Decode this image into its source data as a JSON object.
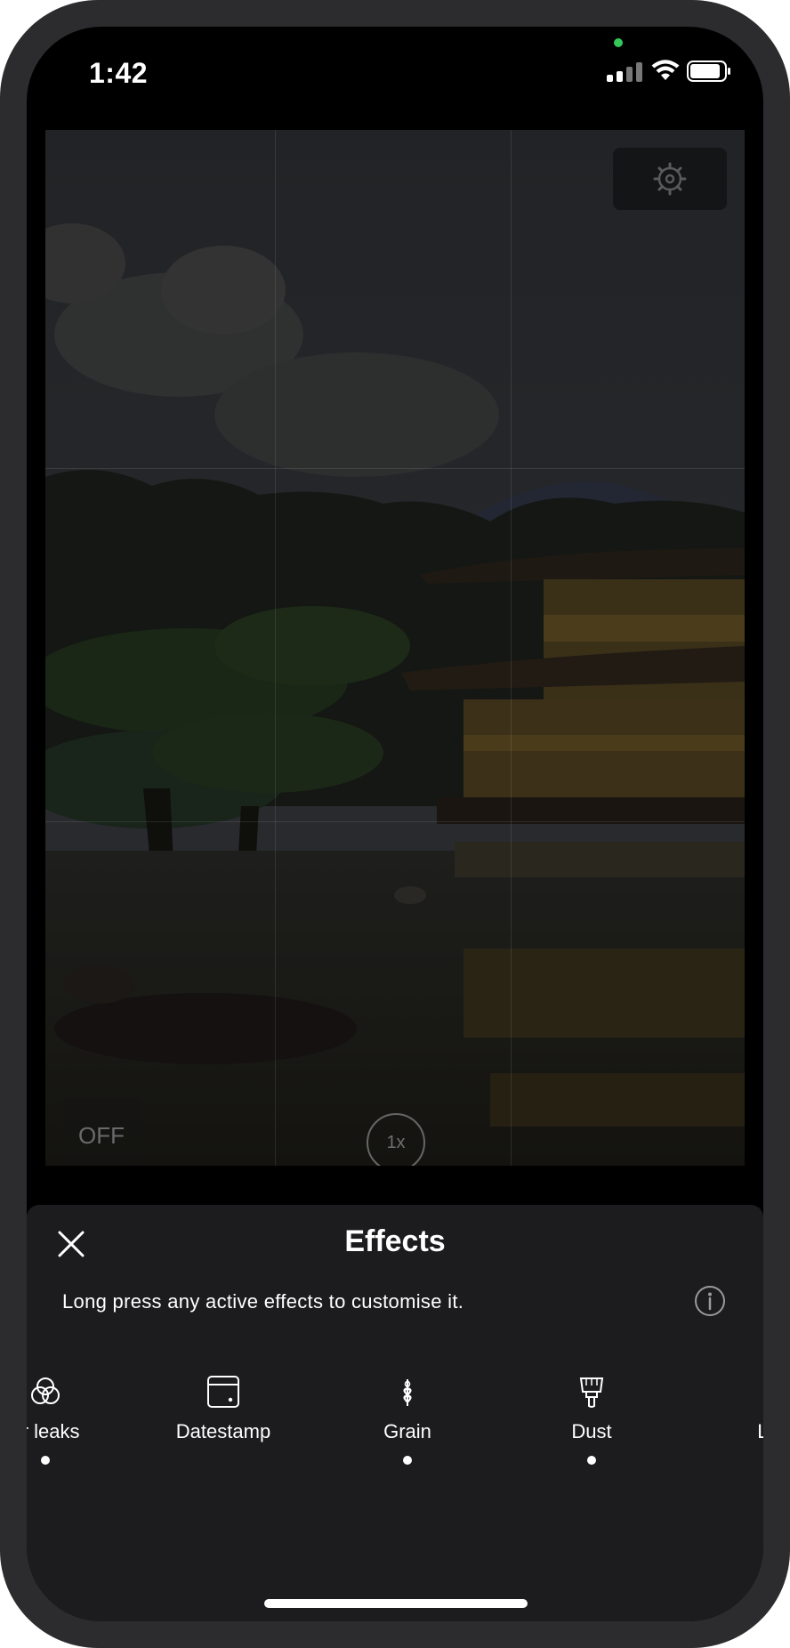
{
  "status_bar": {
    "time": "1:42"
  },
  "camera": {
    "flash_label": "OFF",
    "zoom_label": "1x",
    "settings_icon": "gear-icon"
  },
  "effects_sheet": {
    "title": "Effects",
    "hint": "Long press any active effects to customise it.",
    "close_icon": "close-icon",
    "info_icon": "info-icon",
    "items": [
      {
        "label": "ur leaks",
        "icon": "colour-leaks-icon",
        "active": true
      },
      {
        "label": "Datestamp",
        "icon": "datestamp-icon",
        "active": false
      },
      {
        "label": "Grain",
        "icon": "grain-icon",
        "active": true
      },
      {
        "label": "Dust",
        "icon": "dust-icon",
        "active": true
      },
      {
        "label": "Ligh",
        "icon": "light-icon",
        "active": false
      }
    ]
  },
  "colors": {
    "sheet_bg": "#1c1c1e",
    "device_frame": "#2c2c2e",
    "camera_indicator": "#34c759",
    "text_primary": "#ffffff"
  }
}
